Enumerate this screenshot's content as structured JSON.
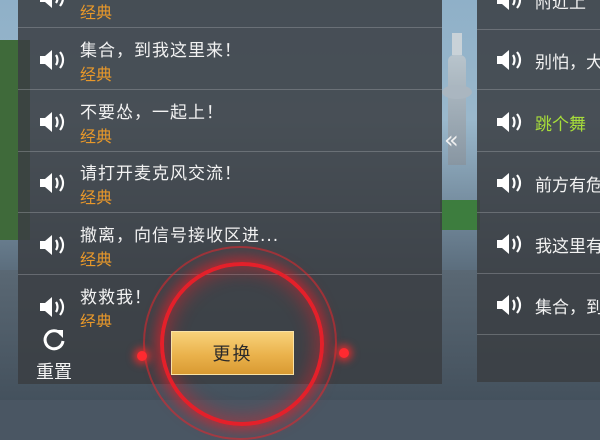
{
  "left_list": [
    {
      "text": "",
      "tag": "经典"
    },
    {
      "text": "集合，到我这里来！",
      "tag": "经典"
    },
    {
      "text": "不要怂，一起上！",
      "tag": "经典"
    },
    {
      "text": "请打开麦克风交流！",
      "tag": "经典"
    },
    {
      "text": "撤离，向信号接收区进...",
      "tag": "经典"
    },
    {
      "text": "救救我！",
      "tag": "经典"
    }
  ],
  "right_list": [
    {
      "text": "附近上"
    },
    {
      "text": "别怕，大"
    },
    {
      "text": "跳个舞",
      "highlight_color": "#a7dd3a"
    },
    {
      "text": "前方有危"
    },
    {
      "text": "我这里有"
    },
    {
      "text": "集合，到"
    }
  ],
  "controls": {
    "reset_label": "重置",
    "swap_label": "更换",
    "collapse_glyph": "«"
  },
  "icons": {
    "speaker": "speaker-icon",
    "reset": "refresh-icon",
    "collapse": "double-chevron-left-icon"
  },
  "colors": {
    "tag_orange": "#e8982a",
    "ring_red": "#e4202a",
    "button_gold": "#eab24c"
  }
}
